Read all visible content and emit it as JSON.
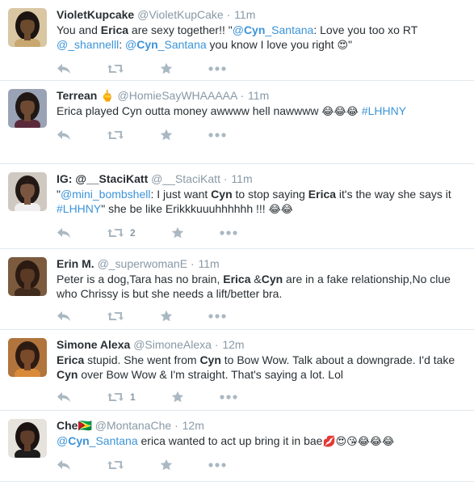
{
  "tweets": [
    {
      "fullname": "VioletKupcake",
      "handle": "@VioletKupCake",
      "dot": "·",
      "time": "11m",
      "retweets": "",
      "text": [
        {
          "t": "You and "
        },
        {
          "t": "Erica",
          "b": true
        },
        {
          "t": " are sexy together!! \""
        },
        {
          "t": "@",
          "link": true
        },
        {
          "t": "Cyn",
          "b": true,
          "link": true
        },
        {
          "t": "_Santana",
          "link": true
        },
        {
          "t": ": Love you too xo RT "
        },
        {
          "t": "@_shannelll",
          "link": true
        },
        {
          "t": ": "
        },
        {
          "t": "@",
          "link": true
        },
        {
          "t": "Cyn",
          "b": true,
          "link": true
        },
        {
          "t": "_Santana",
          "link": true
        },
        {
          "t": " you know I love you right "
        },
        {
          "t": "😍",
          "emoji": true
        },
        {
          "t": "\""
        }
      ]
    },
    {
      "fullname": "Terrean",
      "fullname_suffix": "🖕",
      "handle": "@HomieSayWHAAAAA",
      "dot": "·",
      "time": "11m",
      "retweets": "",
      "text": [
        {
          "t": "Erica played Cyn outta money awwww hell nawwww "
        },
        {
          "t": "😂😂😂",
          "emoji": true
        },
        {
          "t": " "
        },
        {
          "t": "#LHHNY",
          "link": true
        }
      ]
    },
    {
      "fullname": "IG: @__StaciKatt",
      "handle": "@__StaciKatt",
      "dot": "·",
      "time": "11m",
      "retweets": "2",
      "text": [
        {
          "t": "\""
        },
        {
          "t": "@mini_bombshell",
          "link": true
        },
        {
          "t": ": I just want "
        },
        {
          "t": "Cyn",
          "b": true
        },
        {
          "t": " to stop saying "
        },
        {
          "t": "Erica",
          "b": true
        },
        {
          "t": " it's the way she says it "
        },
        {
          "t": "#LHHNY",
          "link": true
        },
        {
          "t": "\" she be like Erikkkuuuhhhhhh !!! "
        },
        {
          "t": "😂😂",
          "emoji": true
        }
      ]
    },
    {
      "fullname": "Erin M.",
      "handle": "@_superwomanE",
      "dot": "·",
      "time": "11m",
      "retweets": "",
      "text": [
        {
          "t": "Peter is a dog,Tara has no brain, "
        },
        {
          "t": "Erica",
          "b": true
        },
        {
          "t": " &"
        },
        {
          "t": "Cyn",
          "b": true
        },
        {
          "t": " are in a fake relationship,No clue who Chrissy is but she needs a lift/better bra."
        }
      ]
    },
    {
      "fullname": "Simone Alexa",
      "handle": "@SimoneAlexa",
      "dot": "·",
      "time": "12m",
      "retweets": "1",
      "text": [
        {
          "t": "Erica",
          "b": true
        },
        {
          "t": " stupid. She went from "
        },
        {
          "t": "Cyn",
          "b": true
        },
        {
          "t": " to Bow Wow. Talk about a downgrade. I'd take "
        },
        {
          "t": "Cyn",
          "b": true
        },
        {
          "t": " over Bow Wow & I'm straight. That's saying a lot. Lol"
        }
      ]
    },
    {
      "fullname": "Che🇬🇾",
      "handle": "@MontanaChe",
      "dot": "·",
      "time": "12m",
      "retweets": "",
      "text": [
        {
          "t": "@",
          "link": true
        },
        {
          "t": "Cyn",
          "b": true,
          "link": true
        },
        {
          "t": "_Santana",
          "link": true
        },
        {
          "t": " erica wanted to act up bring it in bae"
        },
        {
          "t": "💋😍😘😂😂😂",
          "emoji": true
        }
      ]
    }
  ],
  "avatars": [
    {
      "icon": "avatar-violetkupcake",
      "bg": "#d9c7a3",
      "skin": "#6b4a2e",
      "hair": "#1b1410",
      "shirt": "#c8a870"
    },
    {
      "icon": "avatar-terrean",
      "bg": "#9aa3b5",
      "skin": "#6e4a33",
      "hair": "#1f1714",
      "shirt": "#5b2a3a"
    },
    {
      "icon": "avatar-stacikatt",
      "bg": "#cfc9c2",
      "skin": "#7a5640",
      "hair": "#221915",
      "shirt": "#efefef"
    },
    {
      "icon": "avatar-erin-m",
      "bg": "#7b5a3e",
      "skin": "#5a3a24",
      "hair": "#2a1a12",
      "shirt": "#3f2a1c"
    },
    {
      "icon": "avatar-simone-alexa",
      "bg": "#b0743c",
      "skin": "#7a4a2a",
      "hair": "#2c1b12",
      "shirt": "#d98a3a"
    },
    {
      "icon": "avatar-che",
      "bg": "#e6e2dc",
      "skin": "#5e3d2a",
      "hair": "#1a1210",
      "shirt": "#1d1d1d"
    }
  ],
  "colors": {
    "link": "#3b94d9",
    "muted": "#8899a6",
    "action_icon": "#aab8c2",
    "divider": "#e1e8ed"
  },
  "action_icons": [
    "reply-icon",
    "retweet-icon",
    "favorite-icon",
    "more-icon"
  ]
}
